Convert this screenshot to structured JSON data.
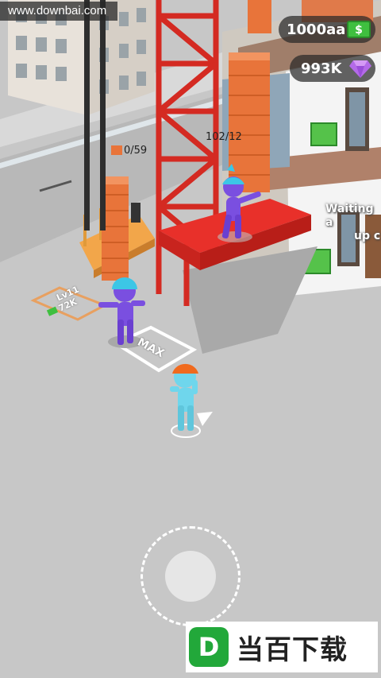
{
  "watermark": "www.downbai.com",
  "hud": {
    "money": "1000aa",
    "money_icon": "cash-icon",
    "gems": "993K",
    "gem_icon": "diamond-icon"
  },
  "world": {
    "brick_counter_left": "0/59",
    "brick_counter_right": "102/12",
    "waiting_line1": "Waiting a",
    "waiting_line2": "up c",
    "upgrade_level": "Lv11",
    "upgrade_cost": "72K",
    "max_label": "MAX"
  },
  "banner": {
    "logo_letter": "D",
    "text": "当百下载"
  },
  "colors": {
    "crane_red": "#e0302a",
    "brick_orange": "#e8743a",
    "worker_purple": "#7a4fe0",
    "worker_cyan": "#6fd6ec",
    "helmet_orange": "#f06a1e",
    "helmet_cyan": "#3cc6e6"
  }
}
